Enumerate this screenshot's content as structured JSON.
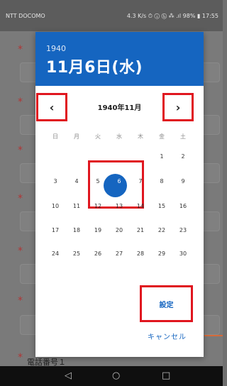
{
  "status_bar": {
    "carrier": "NTT DOCOMO",
    "right": "4.3 K/s  ⏱ ⓘ ⓑ  ⁂  .ıl 98%  ▮  17:55"
  },
  "background": {
    "bottom_label": "電話番号１"
  },
  "dialog": {
    "header_year": "1940",
    "header_date": "11月6日(水)",
    "month_title": "1940年11月",
    "prev_icon": "‹",
    "next_icon": "›",
    "weekdays": [
      "日",
      "月",
      "火",
      "水",
      "木",
      "金",
      "土"
    ],
    "weeks": [
      [
        "",
        "",
        "",
        "",
        "",
        "1",
        "2"
      ],
      [
        "3",
        "4",
        "5",
        "6",
        "7",
        "8",
        "9"
      ],
      [
        "10",
        "11",
        "12",
        "13",
        "14",
        "15",
        "16"
      ],
      [
        "17",
        "18",
        "19",
        "20",
        "21",
        "22",
        "23"
      ],
      [
        "24",
        "25",
        "26",
        "27",
        "28",
        "29",
        "30"
      ]
    ],
    "selected_day": "6",
    "set_label": "設定",
    "cancel_label": "キャンセル"
  },
  "navigation": {
    "back_icon": "◁",
    "home_icon": "○",
    "recent_icon": "□"
  },
  "colors": {
    "accent": "#1565c0",
    "highlight": "#e0161f"
  }
}
